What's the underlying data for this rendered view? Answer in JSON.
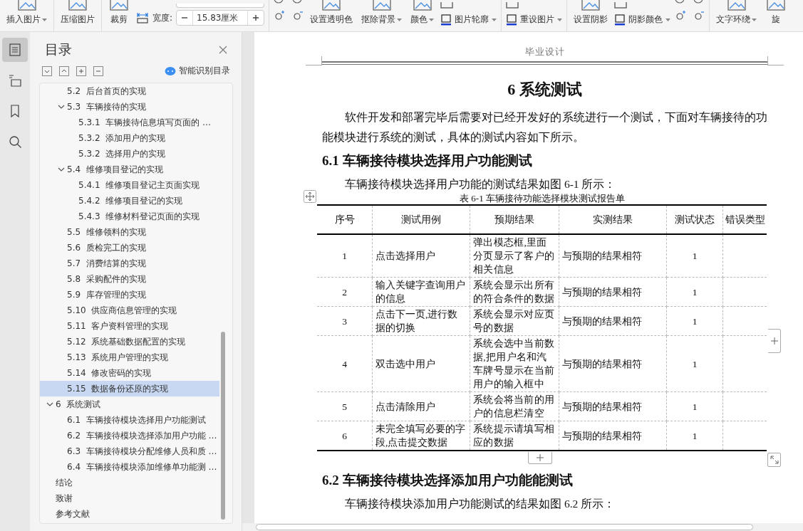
{
  "toolbar": {
    "groups": [
      [
        {
          "kind": "large",
          "label": "插入图片",
          "dropdown": true
        }
      ],
      [
        {
          "kind": "large",
          "label": "压缩图片",
          "dropdown": false
        }
      ],
      [
        {
          "kind": "large",
          "label": "裁剪",
          "dropdown": false
        },
        {
          "kind": "size_field",
          "label": "宽度:",
          "value": "15.83厘米"
        }
      ],
      [
        {
          "kind": "icon_grid"
        },
        {
          "kind": "large",
          "label": "设置透明色",
          "dropdown": false
        },
        {
          "kind": "large",
          "label": "抠除背景",
          "dropdown": true
        },
        {
          "kind": "large",
          "label": "颜色",
          "dropdown": true
        },
        {
          "kind": "small",
          "label": "图片轮廓",
          "dropdown": true
        }
      ],
      [
        {
          "kind": "small",
          "label": "重设图片",
          "dropdown": true
        }
      ],
      [
        {
          "kind": "large",
          "label": "设置阴影",
          "dropdown": false
        },
        {
          "kind": "small",
          "label": "阴影颜色",
          "dropdown": true
        },
        {
          "kind": "icon_grid"
        }
      ],
      [
        {
          "kind": "large",
          "label": "文字环绕",
          "dropdown": true
        },
        {
          "kind": "large",
          "label": "旋",
          "dropdown": false
        }
      ]
    ]
  },
  "toc": {
    "title": "目录",
    "smart_label": "智能识别目录",
    "continued_items": [
      {
        "label": "5.2  后台首页的实现",
        "selected": false
      },
      {
        "label": "5.3  车辆接待的实现",
        "selected": false,
        "expanded": true,
        "children": [
          {
            "label": "5.3.1  车辆接待信息填写页面的 …",
            "selected": false
          },
          {
            "label": "5.3.2  添加用户的实现",
            "selected": false
          },
          {
            "label": "5.3.2  选择用户的实现",
            "selected": false
          }
        ]
      },
      {
        "label": "5.4  维修项目登记的实现",
        "selected": false,
        "expanded": true,
        "children": [
          {
            "label": "5.4.1  维修项目登记主页面实现",
            "selected": false
          },
          {
            "label": "5.4.2  维修项目登记的实现",
            "selected": false
          },
          {
            "label": "5.4.3  维修材料登记页面的实现",
            "selected": false
          }
        ]
      },
      {
        "label": "5.5  维修领料的实现",
        "selected": false
      },
      {
        "label": "5.6  质检完工的实现",
        "selected": false
      },
      {
        "label": "5.7  消费结算的实现",
        "selected": false
      },
      {
        "label": "5.8  采购配件的实现",
        "selected": false
      },
      {
        "label": "5.9  库存管理的实现",
        "selected": false
      },
      {
        "label": "5.10  供应商信息管理的实现",
        "selected": false
      },
      {
        "label": "5.11  客户资料管理的实现",
        "selected": false
      },
      {
        "label": "5.12  系统基础数据配置的实现",
        "selected": false
      },
      {
        "label": "5.13  系统用户管理的实现",
        "selected": false
      },
      {
        "label": "5.14  修改密码的实现",
        "selected": false
      },
      {
        "label": "5.15  数据备份还原的实现",
        "selected": true
      }
    ],
    "items": [
      {
        "label": "6  系统测试",
        "selected": false,
        "expanded": true,
        "children": [
          {
            "label": "6.1  车辆接待模块选择用户功能测试",
            "selected": false
          },
          {
            "label": "6.2  车辆接待模块选择添加用户功能 …",
            "selected": false
          },
          {
            "label": "6.3  车辆接待模块分配维修人员和质 …",
            "selected": false
          },
          {
            "label": "6.4  车辆接待模块添加维修单功能测 …",
            "selected": false
          }
        ]
      },
      {
        "label": "结论",
        "selected": false
      },
      {
        "label": "致谢",
        "selected": false
      },
      {
        "label": "参考文献",
        "selected": false
      }
    ]
  },
  "document": {
    "header": "毕业设计",
    "chapter_title": "6  系统测试",
    "intro": "软件开发和部署完毕后需要对已经开发好的系统进行一个测试，下面对车辆接待的功能模块进行系统的测试，具体的测试内容如下所示。",
    "sections": [
      {
        "title": "6.1  车辆接待模块选择用户功能测试",
        "lead": "车辆接待模块选择用户功能的测试结果如图 6-1 所示：",
        "table": {
          "caption": "表 6-1  车辆接待功能选择模块测试报告单",
          "columns": [
            "序号",
            "测试用例",
            "预期结果",
            "实测结果",
            "测试状态",
            "错误类型"
          ],
          "rows": [
            [
              "1",
              "点击选择用户",
              "弹出模态框,里面分页显示了客户的相关信息",
              "与预期的结果相符",
              "1"
            ],
            [
              "2",
              "输入关键字查询用户的信息",
              "系统会显示出所有的符合条件的数据",
              "与预期的结果相符",
              "1"
            ],
            [
              "3",
              "点击下一页,进行数据的切换",
              "系统会显示对应页号的数据",
              "与预期的结果相符",
              "1"
            ],
            [
              "4",
              "双击选中用户",
              "系统会选中当前数据,把用户名和汽车牌号显示在当前用户的输入框中",
              "与预期的结果相符",
              "1"
            ],
            [
              "5",
              "点击清除用户",
              "系统会将当前的用户的信息栏清空",
              "与预期的结果相符",
              "1"
            ],
            [
              "6",
              "未完全填写必要的字段,点击提交数据",
              "系统提示请填写相应的数据",
              "与预期的结果相符",
              "1"
            ]
          ]
        }
      },
      {
        "title": "6.2  车辆接待模块选择添加用户功能能测试",
        "lead": "车辆接待模块添加用户功能测试的结果如图 6.2 所示："
      }
    ]
  }
}
